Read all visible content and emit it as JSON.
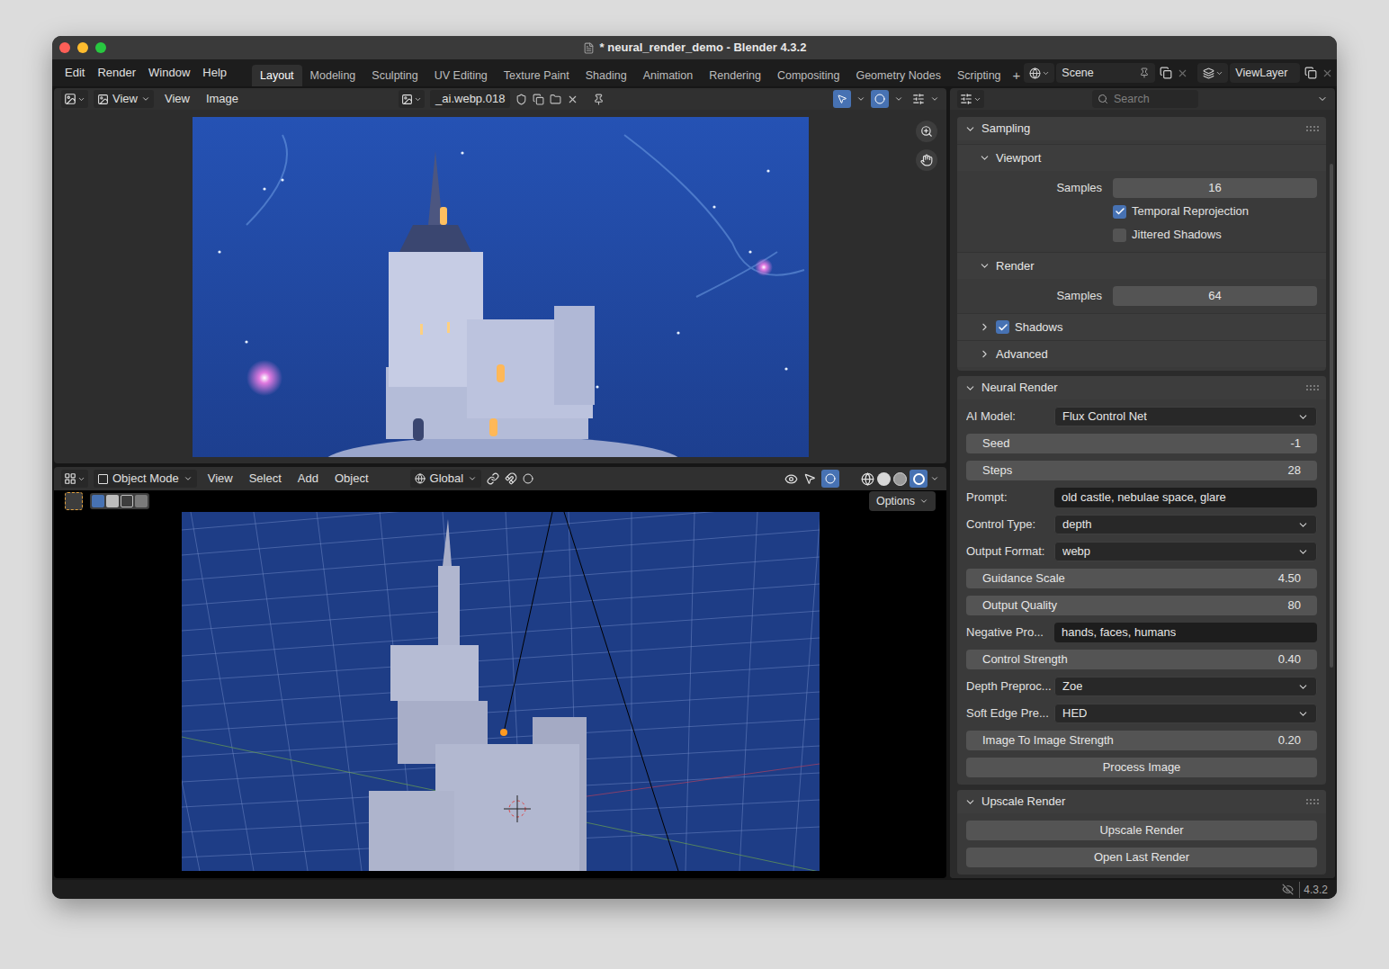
{
  "window": {
    "title": "* neural_render_demo - Blender 4.3.2"
  },
  "menu": [
    "Edit",
    "Render",
    "Window",
    "Help"
  ],
  "workspaces": [
    {
      "label": "Layout",
      "selected": true
    },
    {
      "label": "Modeling",
      "selected": false
    },
    {
      "label": "Sculpting",
      "selected": false
    },
    {
      "label": "UV Editing",
      "selected": false
    },
    {
      "label": "Texture Paint",
      "selected": false
    },
    {
      "label": "Shading",
      "selected": false
    },
    {
      "label": "Animation",
      "selected": false
    },
    {
      "label": "Rendering",
      "selected": false
    },
    {
      "label": "Compositing",
      "selected": false
    },
    {
      "label": "Geometry Nodes",
      "selected": false
    },
    {
      "label": "Scripting",
      "selected": false
    }
  ],
  "add_workspace": "+",
  "scene": "Scene",
  "view_layer": "ViewLayer",
  "image_editor": {
    "view_mode": "View",
    "menus": [
      "View",
      "Image"
    ],
    "image_name": "_ai.webp.018"
  },
  "viewport": {
    "mode": "Object Mode",
    "menus": [
      "View",
      "Select",
      "Add",
      "Object"
    ],
    "orientation": "Global",
    "options": "Options"
  },
  "properties": {
    "search_placeholder": "Search",
    "panels": [
      {
        "title": "Sampling",
        "expanded": true,
        "rows": [],
        "subpanels": [
          {
            "title": "Viewport",
            "kind": "plain",
            "expanded": true,
            "rows": [
              {
                "kind": "label_number",
                "label": "Samples",
                "value": "16"
              },
              {
                "kind": "checkbox",
                "label": "Temporal Reprojection",
                "checked": true
              },
              {
                "kind": "checkbox",
                "label": "Jittered Shadows",
                "checked": false
              }
            ]
          },
          {
            "title": "Render",
            "kind": "plain",
            "expanded": true,
            "rows": [
              {
                "kind": "label_number",
                "label": "Samples",
                "value": "64"
              }
            ]
          },
          {
            "title": "Shadows",
            "kind": "checkbox",
            "checked": true,
            "expanded": false,
            "rows": []
          },
          {
            "title": "Advanced",
            "kind": "plain",
            "expanded": false,
            "rows": []
          }
        ]
      },
      {
        "title": "Neural Render",
        "expanded": true,
        "subpanels": [],
        "rows": [
          {
            "kind": "dropdown",
            "label": "AI Model:",
            "value": "Flux Control Net"
          },
          {
            "kind": "number",
            "label": "Seed",
            "value": "-1"
          },
          {
            "kind": "number",
            "label": "Steps",
            "value": "28"
          },
          {
            "kind": "text",
            "label": "Prompt:",
            "value": "old castle, nebulae space, glare"
          },
          {
            "kind": "dropdown",
            "label": "Control Type:",
            "value": "depth"
          },
          {
            "kind": "dropdown",
            "label": "Output Format:",
            "value": "webp"
          },
          {
            "kind": "number",
            "label": "Guidance Scale",
            "value": "4.50"
          },
          {
            "kind": "number",
            "label": "Output Quality",
            "value": "80"
          },
          {
            "kind": "text",
            "label": "Negative Pro...",
            "value": "hands, faces, humans"
          },
          {
            "kind": "number",
            "label": "Control Strength",
            "value": "0.40"
          },
          {
            "kind": "dropdown",
            "label": "Depth Preproc...",
            "value": "Zoe"
          },
          {
            "kind": "dropdown",
            "label": "Soft Edge Pre...",
            "value": "HED"
          },
          {
            "kind": "number",
            "label": "Image To Image Strength",
            "value": "0.20"
          },
          {
            "kind": "button",
            "label": "Process Image"
          }
        ]
      },
      {
        "title": "Upscale Render",
        "expanded": true,
        "subpanels": [],
        "rows": [
          {
            "kind": "button",
            "label": "Upscale Render"
          },
          {
            "kind": "button",
            "label": "Open Last Render"
          }
        ]
      }
    ]
  },
  "status_bar": {
    "version": "4.3.2"
  }
}
